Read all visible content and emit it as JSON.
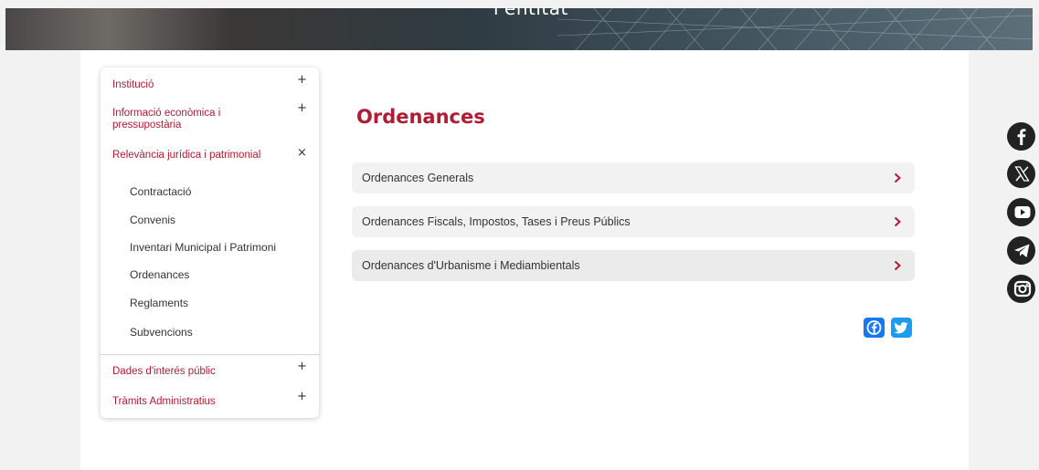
{
  "hero": {
    "title": "l'entitat"
  },
  "sidebar": {
    "items": [
      {
        "label": "Institució",
        "toggle": "+"
      },
      {
        "label": "Informació econòmica i pressupostària",
        "toggle": "+"
      },
      {
        "label": "Relevància jurídica i patrimonial",
        "toggle": "×"
      },
      {
        "label": "Dades d'interés públic",
        "toggle": "+"
      },
      {
        "label": "Tràmits Administratius",
        "toggle": "+"
      }
    ],
    "subitems": [
      "Contractació",
      "Convenis",
      "Inventari Municipal i Patrimoni",
      "Ordenances",
      "Reglaments",
      "Subvencions"
    ]
  },
  "main": {
    "title": "Ordenances",
    "accordion": [
      {
        "label": "Ordenances Generals"
      },
      {
        "label": "Ordenances Fiscals, Impostos, Tases i Preus Públics"
      },
      {
        "label": "Ordenances d'Urbanisme i Mediambientals"
      }
    ]
  },
  "share": {
    "icons": [
      "facebook-icon",
      "twitter-icon"
    ]
  },
  "social": {
    "icons": [
      "facebook-icon",
      "x-icon",
      "youtube-icon",
      "telegram-icon",
      "instagram-icon"
    ]
  },
  "colors": {
    "brand": "#b01c33",
    "facebook": "#1877f2",
    "twitter": "#1d9bf0",
    "social_disc": "#222222"
  }
}
